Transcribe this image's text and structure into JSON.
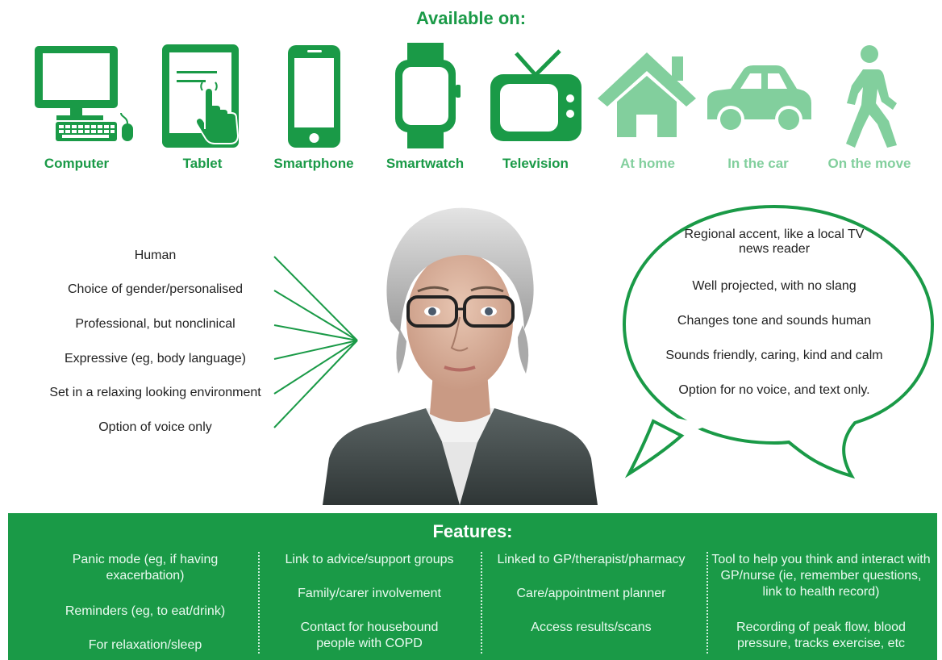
{
  "header": {
    "title": "Available on:"
  },
  "devices": [
    {
      "label": "Computer",
      "icon": "computer-icon",
      "color": "#1a9a47"
    },
    {
      "label": "Tablet",
      "icon": "tablet-icon",
      "color": "#1a9a47"
    },
    {
      "label": "Smartphone",
      "icon": "smartphone-icon",
      "color": "#1a9a47"
    },
    {
      "label": "Smartwatch",
      "icon": "smartwatch-icon",
      "color": "#1a9a47"
    },
    {
      "label": "Television",
      "icon": "television-icon",
      "color": "#1a9a47"
    },
    {
      "label": "At home",
      "icon": "house-icon",
      "color": "#82cf9d"
    },
    {
      "label": "In the car",
      "icon": "car-icon",
      "color": "#82cf9d"
    },
    {
      "label": "On the move",
      "icon": "walking-person-icon",
      "color": "#82cf9d"
    }
  ],
  "appearance": [
    "Human",
    "Choice of gender/personalised",
    "Professional, but nonclinical",
    "Expressive (eg, body language)",
    "Set in a relaxing looking environment",
    "Option of voice only"
  ],
  "voice": [
    "Regional accent, like a local TV news reader",
    "Well projected, with no slang",
    "Changes tone and sounds human",
    "Sounds friendly, caring, kind and calm",
    "Option for no voice, and text only."
  ],
  "features": {
    "title": "Features:",
    "columns": [
      [
        "Panic mode (eg, if having exacerbation)",
        "Reminders (eg, to eat/drink)",
        "For relaxation/sleep"
      ],
      [
        "Link to advice/support groups",
        "Family/carer involvement",
        "Contact for housebound people with COPD"
      ],
      [
        "Linked to GP/therapist/pharmacy",
        "Care/appointment planner",
        "Access results/scans"
      ],
      [
        "Tool to help you think and interact with GP/nurse (ie, remember questions, link to health record)",
        "Recording of peak flow, blood pressure, tracks exercise, etc"
      ]
    ]
  },
  "colors": {
    "accent": "#1a9a47",
    "light_accent": "#82cf9d"
  }
}
